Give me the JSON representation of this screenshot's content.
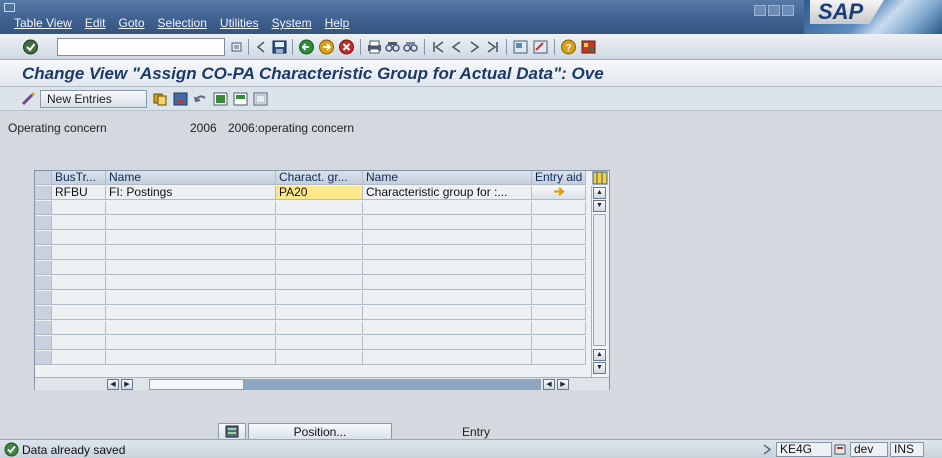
{
  "menubar": {
    "items": [
      "Table View",
      "Edit",
      "Goto",
      "Selection",
      "Utilities",
      "System",
      "Help"
    ],
    "logo": "SAP"
  },
  "title": "Change View \"Assign CO-PA Characteristic Group for Actual Data\": Ove",
  "app_toolbar": {
    "new_entries_label": "New Entries"
  },
  "header_fields": {
    "label": "Operating concern",
    "value": "2006",
    "description": "2006:operating concern"
  },
  "table": {
    "columns": [
      "BusTr...",
      "Name",
      "Charact. gr...",
      "Name",
      "Entry aid"
    ],
    "rows": [
      {
        "bus_tr": "RFBU",
        "name": "FI: Postings",
        "charact_group": "PA20",
        "char_name": "Characteristic group for :..."
      }
    ]
  },
  "position": {
    "button_label": "Position...",
    "entry_label": "Entry"
  },
  "statusbar": {
    "message": "Data already saved",
    "transaction": "KE4G",
    "system": "dev",
    "mode": "INS"
  },
  "colors": {
    "title": "#1c3a66",
    "menubar": "#3f608e",
    "highlight": "#ffe88a"
  }
}
